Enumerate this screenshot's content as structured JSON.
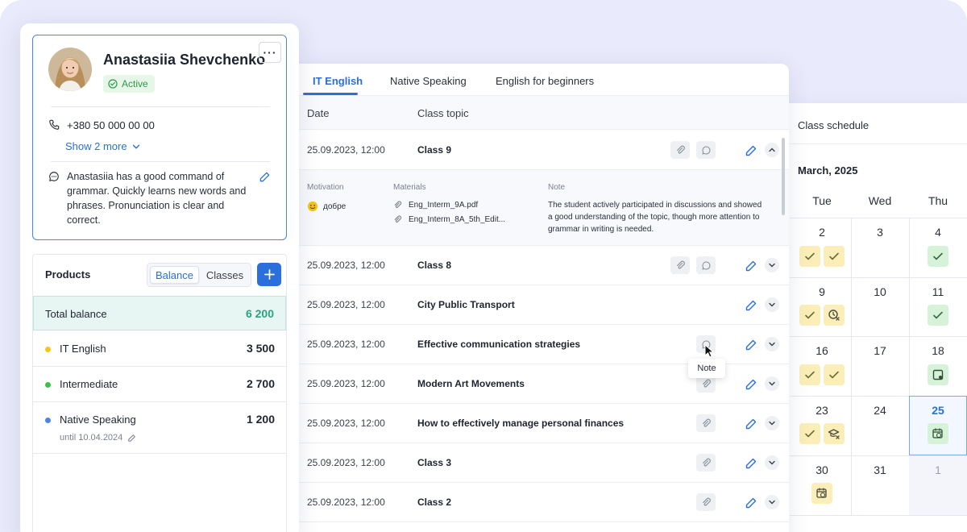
{
  "profile": {
    "name": "Anastasiia Shevchenko",
    "status": "Active",
    "more_label": "···",
    "phone": "+380 50 000 00 00",
    "show_more": "Show 2 more",
    "comment": "Anastasiia has a good command of grammar. Quickly learns new words and phrases. Pronunciation is clear and correct."
  },
  "products": {
    "title": "Products",
    "toggle": [
      "Balance",
      "Classes"
    ],
    "total_label": "Total balance",
    "total_amount": "6 200",
    "items": [
      {
        "name": "IT English",
        "amount": "3 500",
        "color": "#f5c518"
      },
      {
        "name": "Intermediate",
        "amount": "2 700",
        "color": "#3cc04d"
      },
      {
        "name": "Native Speaking",
        "amount": "1 200",
        "color": "#4a86e0",
        "until": "until 10.04.2024"
      }
    ]
  },
  "tabs": [
    "IT English",
    "Native Speaking",
    "English for beginners"
  ],
  "table": {
    "headers": {
      "date": "Date",
      "topic": "Class topic"
    },
    "expanded": {
      "motivation_label": "Motivation",
      "motivation_value": "добре",
      "materials_label": "Materials",
      "materials": [
        "Eng_Interm_9A.pdf",
        "Eng_Interm_8A_5th_Edit..."
      ],
      "note_label": "Note",
      "note": "The student actively participated in discussions and showed a good understanding of the topic, though more attention to grammar in writing is needed."
    },
    "rows": [
      {
        "date": "25.09.2023, 12:00",
        "topic": "Class 9"
      },
      {
        "date": "25.09.2023, 12:00",
        "topic": "Class 8"
      },
      {
        "date": "25.09.2023, 12:00",
        "topic": "City Public Transport"
      },
      {
        "date": "25.09.2023, 12:00",
        "topic": "Effective communication strategies"
      },
      {
        "date": "25.09.2023, 12:00",
        "topic": "Modern Art Movements"
      },
      {
        "date": "25.09.2023, 12:00",
        "topic": "How to effectively manage personal finances"
      },
      {
        "date": "25.09.2023, 12:00",
        "topic": "Class 3"
      },
      {
        "date": "25.09.2023, 12:00",
        "topic": "Class 2"
      }
    ],
    "tooltip": "Note"
  },
  "calendar": {
    "title": "Class schedule",
    "month": "March, 2025",
    "weekdays": [
      "Tue",
      "Wed",
      "Thu"
    ],
    "days": [
      "2",
      "3",
      "4",
      "9",
      "10",
      "11",
      "16",
      "17",
      "18",
      "23",
      "24",
      "25",
      "30",
      "31",
      "1"
    ]
  },
  "colors": {
    "accent": "#2a6fdb",
    "active_green": "#2e9a47",
    "total_green": "#2aa37f",
    "badge_yellow": "#fbeeb8",
    "badge_green": "#d6f2d9"
  }
}
